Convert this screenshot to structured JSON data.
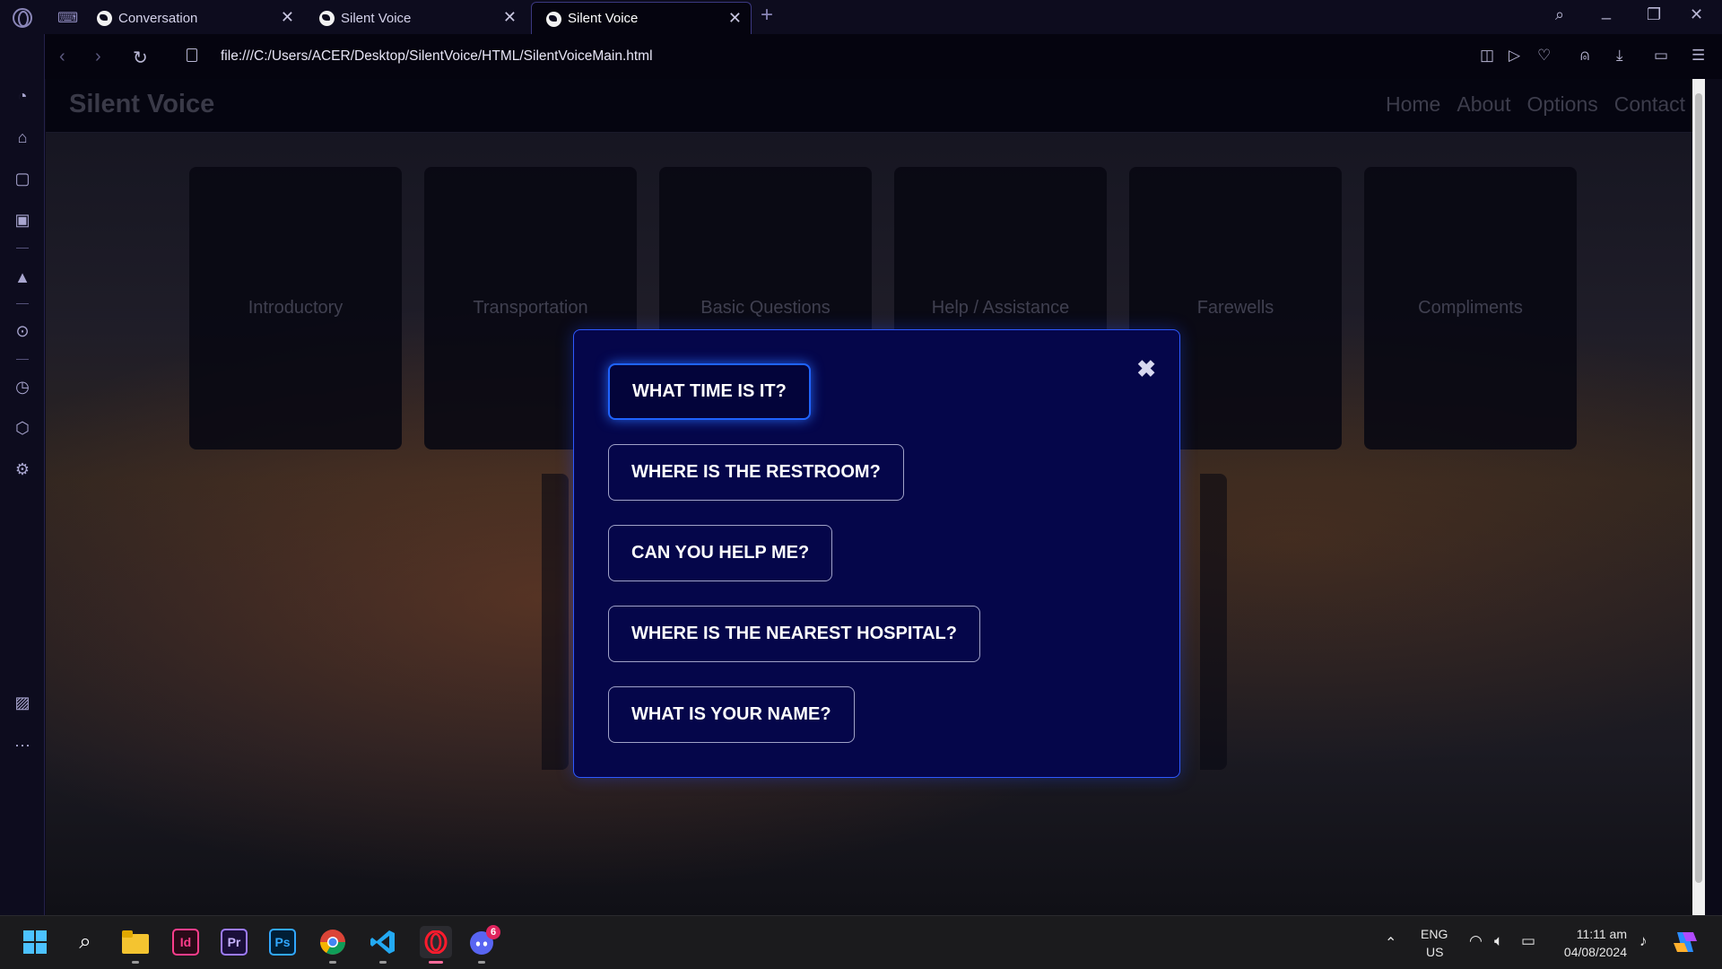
{
  "browser": {
    "tabs": [
      {
        "title": "Conversation",
        "active": false
      },
      {
        "title": "Silent Voice",
        "active": false
      },
      {
        "title": "Silent Voice",
        "active": true
      }
    ],
    "url": "file:///C:/Users/ACER/Desktop/SilentVoice/HTML/SilentVoiceMain.html"
  },
  "site": {
    "brand": "Silent Voice",
    "nav": [
      "Home",
      "About",
      "Options",
      "Contact"
    ]
  },
  "categories": [
    "Introductory",
    "Transportation",
    "Basic Questions",
    "Help / Assistance",
    "Farewells",
    "Compliments"
  ],
  "modal": {
    "close_symbol": "✖",
    "questions": [
      "WHAT TIME IS IT?",
      "WHERE IS THE RESTROOM?",
      "CAN YOU HELP ME?",
      "WHERE IS THE NEAREST HOSPITAL?",
      "WHAT IS YOUR NAME?"
    ],
    "highlighted_index": 0,
    "accent_color": "#2e59ff",
    "background_color": "#05064a"
  },
  "taskbar": {
    "apps": [
      "Id",
      "Pr",
      "Ps"
    ],
    "discord_badge": "6",
    "language": "ENG",
    "region": "US",
    "time": "11:11 am",
    "date": "04/08/2024"
  }
}
